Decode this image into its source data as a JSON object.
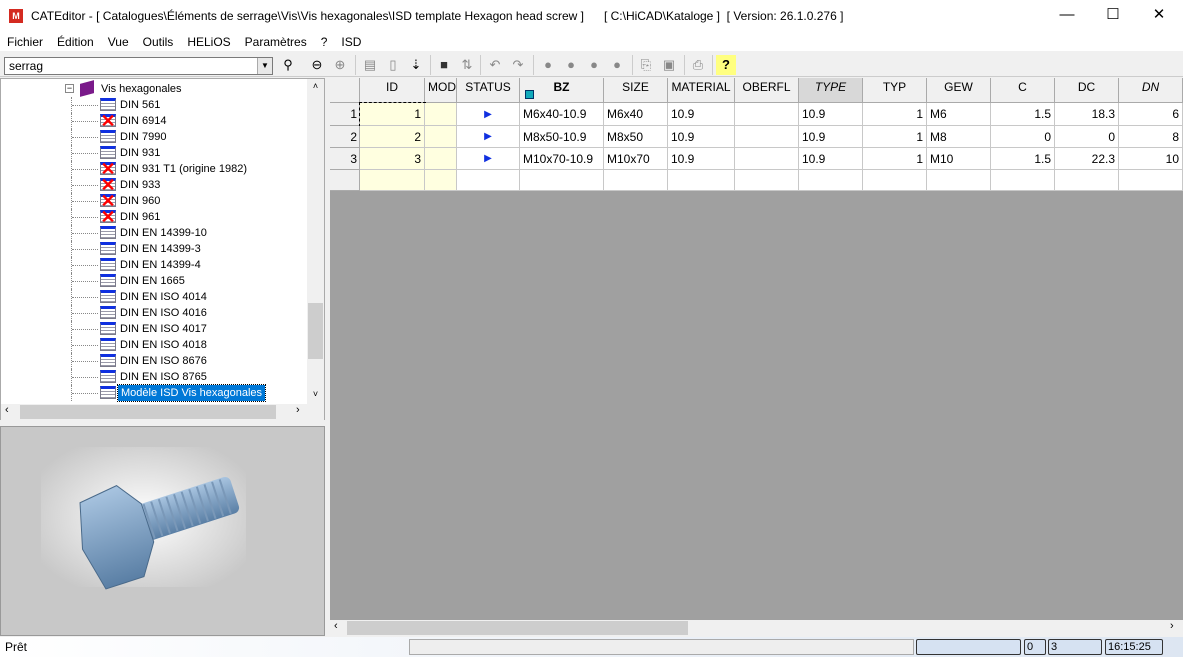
{
  "window": {
    "title": "CATEditor - [ Catalogues\\Éléments de serrage\\Vis\\Vis hexagonales\\ISD template Hexagon head screw ]      [ C:\\HiCAD\\Kataloge ]  [ Version: 26.1.0.276 ]",
    "minimize": "—",
    "maximize": "☐",
    "close": "✕"
  },
  "menu": [
    "Fichier",
    "Édition",
    "Vue",
    "Outils",
    "HELiOS",
    "Paramètres",
    "?",
    "ISD"
  ],
  "search": {
    "value": "serrag"
  },
  "tree": {
    "parent": "Vis hexagonales",
    "items": [
      {
        "label": "DIN 561",
        "deleted": false
      },
      {
        "label": "DIN 6914",
        "deleted": true
      },
      {
        "label": "DIN 7990",
        "deleted": false
      },
      {
        "label": "DIN 931",
        "deleted": false
      },
      {
        "label": "DIN 931 T1 (origine 1982)",
        "deleted": true
      },
      {
        "label": "DIN 933",
        "deleted": true
      },
      {
        "label": "DIN 960",
        "deleted": true
      },
      {
        "label": "DIN 961",
        "deleted": true
      },
      {
        "label": "DIN EN 14399-10",
        "deleted": false
      },
      {
        "label": "DIN EN 14399-3",
        "deleted": false
      },
      {
        "label": "DIN EN 14399-4",
        "deleted": false
      },
      {
        "label": "DIN EN 1665",
        "deleted": false
      },
      {
        "label": "DIN EN ISO 4014",
        "deleted": false
      },
      {
        "label": "DIN EN ISO 4016",
        "deleted": false
      },
      {
        "label": "DIN EN ISO 4017",
        "deleted": false
      },
      {
        "label": "DIN EN ISO 4018",
        "deleted": false
      },
      {
        "label": "DIN EN ISO 8676",
        "deleted": false
      },
      {
        "label": "DIN EN ISO 8765",
        "deleted": false
      },
      {
        "label": "Modèle ISD Vis hexagonales",
        "deleted": false,
        "selected": true
      }
    ]
  },
  "grid": {
    "columns": [
      "ID",
      "MOD",
      "STATUS",
      "BZ",
      "SIZE",
      "MATERIAL",
      "OBERFL",
      "TYPE",
      "TYP",
      "GEW",
      "C",
      "DC",
      "DN"
    ],
    "rows": [
      {
        "n": "1",
        "cells": [
          "1",
          "",
          "▶",
          "M6x40-10.9",
          "M6x40",
          "10.9",
          "",
          "10.9",
          "1",
          "M6",
          "1.5",
          "18.3",
          "6"
        ]
      },
      {
        "n": "2",
        "cells": [
          "2",
          "",
          "▶",
          "M8x50-10.9",
          "M8x50",
          "10.9",
          "",
          "10.9",
          "1",
          "M8",
          "0",
          "0",
          "8"
        ]
      },
      {
        "n": "3",
        "cells": [
          "3",
          "",
          "▶",
          "M10x70-10.9",
          "M10x70",
          "10.9",
          "",
          "10.9",
          "1",
          "M10",
          "1.5",
          "22.3",
          "10"
        ]
      }
    ]
  },
  "status": {
    "text": "Prêt",
    "count1": "0",
    "count2": "3",
    "time": "16:15:25"
  }
}
